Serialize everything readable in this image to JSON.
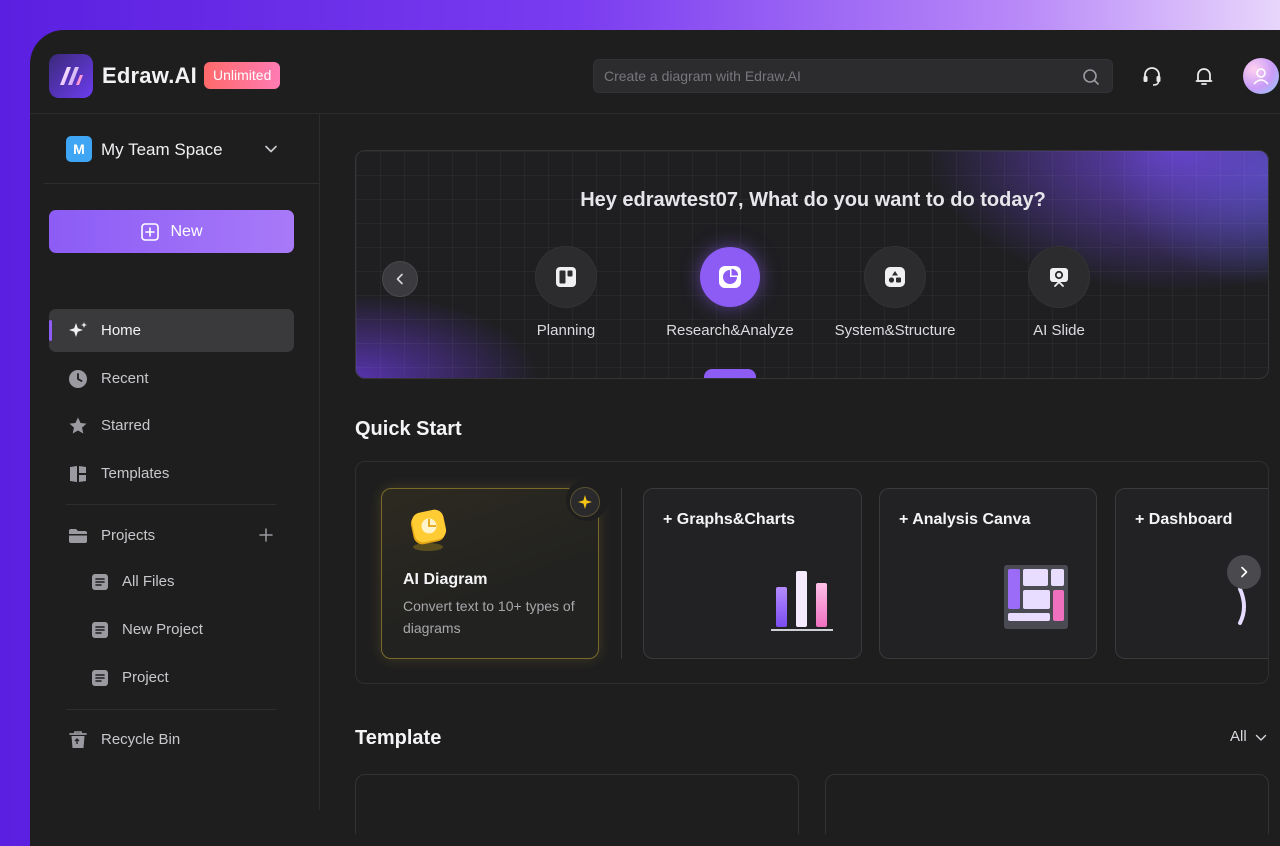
{
  "header": {
    "brand": "Edraw.AI",
    "badge": "Unlimited",
    "search_placeholder": "Create a diagram with Edraw.AI",
    "icons": [
      "logo-icon",
      "search-icon",
      "headset-icon",
      "bell-icon",
      "avatar"
    ]
  },
  "sidebar": {
    "team_initial": "M",
    "team_name": "My Team Space",
    "new_label": "New",
    "nav": {
      "home": "Home",
      "recent": "Recent",
      "starred": "Starred",
      "templates": "Templates",
      "projects": "Projects",
      "recycle_bin": "Recycle Bin"
    },
    "projects": [
      "All Files",
      "New Project",
      "Project"
    ]
  },
  "hero": {
    "greeting": "Hey edrawtest07, What do you want to do today?",
    "categories": [
      "Planning",
      "Research&Analyze",
      "System&Structure",
      "AI Slide"
    ],
    "selected": "Research&Analyze"
  },
  "quick_start": {
    "title": "Quick Start",
    "ai_card": {
      "title": "AI Diagram",
      "description": "Convert text to 10+ types of diagrams"
    },
    "cards": [
      "+ Graphs&Charts",
      "+ Analysis Canva",
      "+ Dashboard"
    ]
  },
  "template": {
    "title": "Template",
    "filter": "All"
  },
  "colors": {
    "accent": "#8c5cf5",
    "badge": "#ff6a8a",
    "background": "#1e1e1f",
    "ai_card_border": "#7a6a2a"
  }
}
